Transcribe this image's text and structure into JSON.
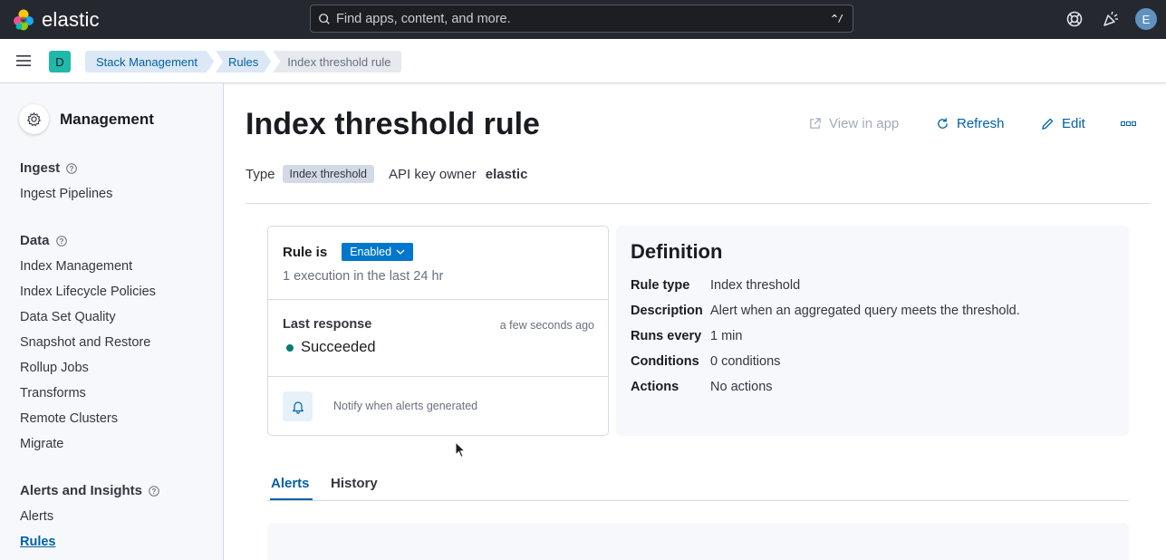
{
  "header": {
    "brand": "elastic",
    "search_placeholder": "Find apps, content, and more.",
    "search_shortcut": "^/",
    "user_initial": "E",
    "icons": [
      "help-icon",
      "newsfeed-icon"
    ]
  },
  "subheader": {
    "space_initial": "D",
    "breadcrumbs": [
      "Stack Management",
      "Rules",
      "Index threshold rule"
    ]
  },
  "sidebar": {
    "title": "Management",
    "sections": [
      {
        "title": "Ingest",
        "items": [
          "Ingest Pipelines"
        ]
      },
      {
        "title": "Data",
        "items": [
          "Index Management",
          "Index Lifecycle Policies",
          "Data Set Quality",
          "Snapshot and Restore",
          "Rollup Jobs",
          "Transforms",
          "Remote Clusters",
          "Migrate"
        ]
      },
      {
        "title": "Alerts and Insights",
        "items": [
          "Alerts",
          "Rules"
        ]
      }
    ],
    "active_item": "Rules"
  },
  "page": {
    "title": "Index threshold rule",
    "actions": {
      "view_in_app": "View in app",
      "refresh": "Refresh",
      "edit": "Edit"
    },
    "type_label": "Type",
    "type_value": "Index threshold",
    "api_key_owner_label": "API key owner",
    "api_key_owner_value": "elastic"
  },
  "status_panel": {
    "rule_is_label": "Rule is",
    "status_button": "Enabled",
    "executions": "1 execution in the last 24 hr",
    "last_response_label": "Last response",
    "last_response_time": "a few seconds ago",
    "last_response_value": "Succeeded",
    "notify_text": "Notify when alerts generated"
  },
  "definition": {
    "title": "Definition",
    "rows": [
      {
        "key": "Rule type",
        "value": "Index threshold"
      },
      {
        "key": "Description",
        "value": "Alert when an aggregated query meets the threshold."
      },
      {
        "key": "Runs every",
        "value": "1 min"
      },
      {
        "key": "Conditions",
        "value": "0 conditions"
      },
      {
        "key": "Actions",
        "value": "No actions"
      }
    ]
  },
  "tabs": [
    {
      "label": "Alerts",
      "active": true
    },
    {
      "label": "History",
      "active": false
    }
  ],
  "colors": {
    "header_bg": "#25282f",
    "accent": "#0061a6",
    "enabled_button": "#0077cc",
    "success": "#017d73"
  }
}
